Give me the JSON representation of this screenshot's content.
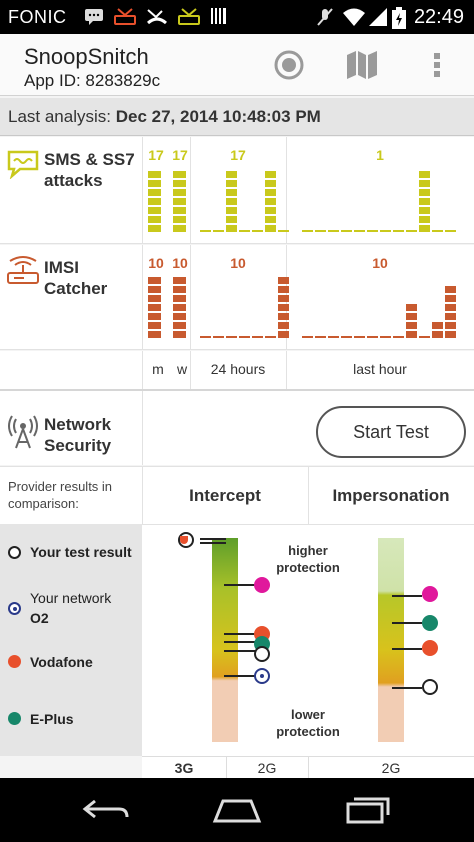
{
  "status_bar": {
    "carrier": "FONIC",
    "time": "22:49"
  },
  "app": {
    "title": "SnoopSnitch",
    "app_id": "App ID: 8283829c"
  },
  "last_analysis": {
    "label": "Last analysis:",
    "value": "Dec 27, 2014 10:48:03 PM"
  },
  "sms_row": {
    "label_line1": "SMS & SS7",
    "label_line2": "attacks",
    "color": "#c9c91c",
    "counts": {
      "m": "17",
      "w": "17",
      "hours": "17",
      "hour": "1"
    },
    "hours_bars": [
      0,
      0,
      1,
      0,
      0,
      1,
      0
    ],
    "hour_bars": [
      0,
      0,
      0,
      0,
      0,
      0,
      0,
      0,
      0,
      1,
      0,
      0
    ]
  },
  "imsi_row": {
    "label_line1": "IMSI",
    "label_line2": "Catcher",
    "color": "#c85a2f",
    "counts": {
      "m": "10",
      "w": "10",
      "hours": "10",
      "hour": "10"
    },
    "hours_bars": [
      0,
      0,
      0,
      0,
      0,
      0,
      1
    ],
    "hour_bars": [
      0,
      0,
      0,
      0,
      0,
      0,
      0,
      0,
      0.5,
      0,
      0.33,
      0.83
    ]
  },
  "axis_labels": {
    "m": "m",
    "w": "w",
    "hours": "24 hours",
    "hour": "last hour"
  },
  "network": {
    "label_line1": "Network",
    "label_line2": "Security",
    "start_test": "Start Test"
  },
  "comparison": {
    "label_line1": "Provider results in",
    "label_line2": "comparison:",
    "intercept": "Intercept",
    "impersonation": "Impersonation",
    "higher_line1": "higher",
    "higher_line2": "protection",
    "lower_line1": "lower",
    "lower_line2": "protection",
    "footer": {
      "tech1": "3G",
      "tech2": "2G",
      "tech3": "2G"
    }
  },
  "legend": [
    {
      "label": "Your test result",
      "label2": "",
      "type": "hollow",
      "color": "#ffffff"
    },
    {
      "label": "Your network",
      "label2": "O2",
      "type": "radio",
      "color": "#2a3a8a"
    },
    {
      "label": "Vodafone",
      "label2": "",
      "type": "filled",
      "color": "#e8502c"
    },
    {
      "label": "E-Plus",
      "label2": "",
      "type": "filled",
      "color": "#17876a"
    }
  ],
  "colors": {
    "accent": "#c9c91c",
    "imsi": "#c85a2f",
    "telekom": "#e0189c"
  }
}
